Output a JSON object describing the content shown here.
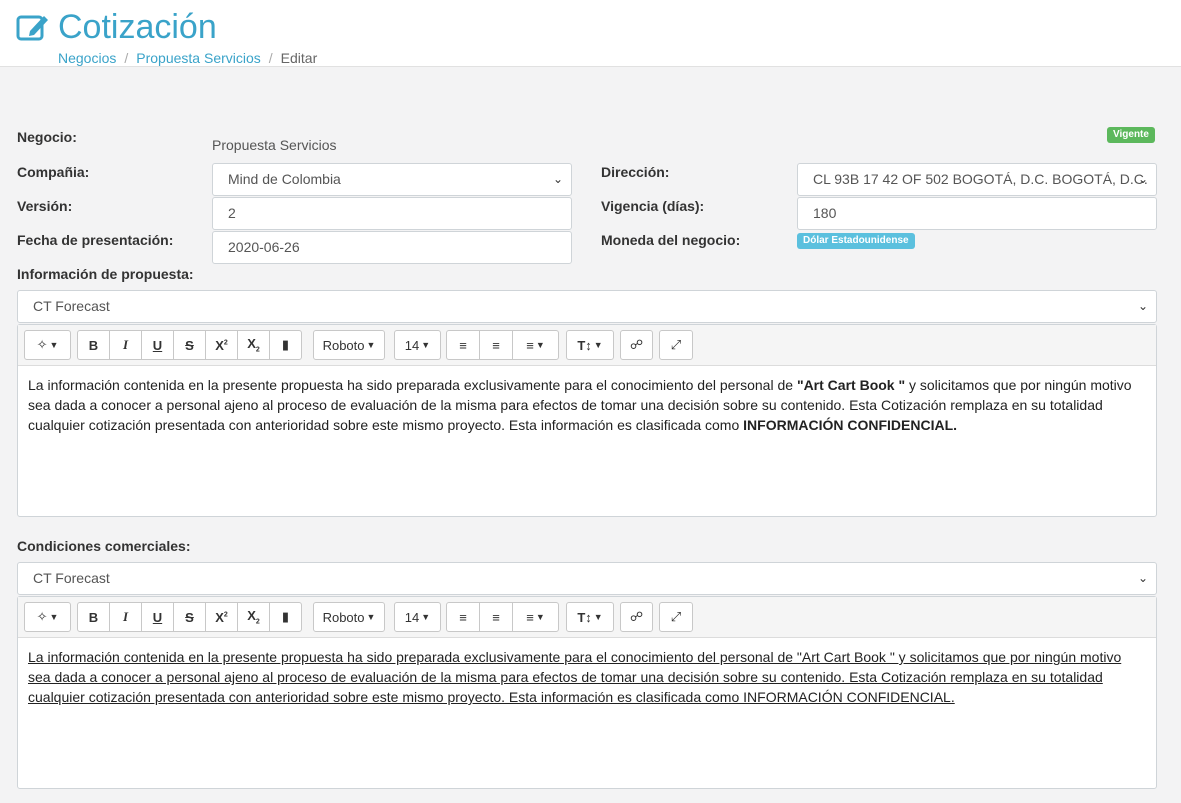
{
  "header": {
    "title": "Cotización",
    "breadcrumb": [
      "Negocios",
      "Propuesta Servicios",
      "Editar"
    ]
  },
  "form": {
    "negocio_label": "Negocio:",
    "negocio_value": "Propuesta Servicios",
    "status_badge": "Vigente",
    "compania_label": "Compañia:",
    "compania_value": "Mind de Colombia",
    "direccion_label": "Dirección:",
    "direccion_value": "CL 93B 17 42 OF 502 BOGOTÁ, D.C. BOGOTÁ, D.C.",
    "version_label": "Versión:",
    "version_value": "2",
    "vigencia_label": "Vigencia (días):",
    "vigencia_value": "180",
    "fecha_label": "Fecha de presentación:",
    "fecha_value": "2020-06-26",
    "moneda_label": "Moneda del negocio:",
    "moneda_badge": "Dólar Estadounidense"
  },
  "propuesta": {
    "label": "Información de propuesta:",
    "template_value": "CT Forecast",
    "body_1": "La información contenida en la presente propuesta ha sido preparada exclusivamente para el conocimiento del personal de ",
    "body_quote": "\"Art Cart Book \"",
    "body_2": " y solicitamos que por ningún motivo sea dada a conocer a personal ajeno al proceso de evaluación de la misma para efectos de tomar una decisión sobre su contenido. Esta Cotización remplaza en su totalidad cualquier cotización presentada con anterioridad sobre este mismo proyecto. Esta información es clasificada como ",
    "body_bold": "INFORMACIÓN CONFIDENCIAL."
  },
  "condiciones": {
    "label": "Condiciones comerciales:",
    "template_value": "CT Forecast",
    "body": "La información contenida en la presente propuesta ha sido preparada exclusivamente para el conocimiento del personal de \"Art Cart Book \" y solicitamos que por ningún motivo sea dada a conocer a personal ajeno al proceso de evaluación de la misma para efectos de tomar una decisión sobre su contenido. Esta Cotización remplaza en su totalidad cualquier cotización presentada con anterioridad sobre este mismo proyecto. Esta información es clasificada como INFORMACIÓN CONFIDENCIAL."
  },
  "toolbar": {
    "font_name": "Roboto",
    "font_size": "14",
    "icons": [
      "magic-wand",
      "bold",
      "italic",
      "underline",
      "strikethrough",
      "superscript",
      "subscript",
      "eraser",
      "font-family",
      "font-size",
      "unordered-list",
      "ordered-list",
      "paragraph-align",
      "line-height",
      "link",
      "fullscreen"
    ]
  },
  "colors": {
    "accent": "#3aa3c9",
    "badge_green": "#5cb85c",
    "badge_blue": "#5bc0de"
  }
}
